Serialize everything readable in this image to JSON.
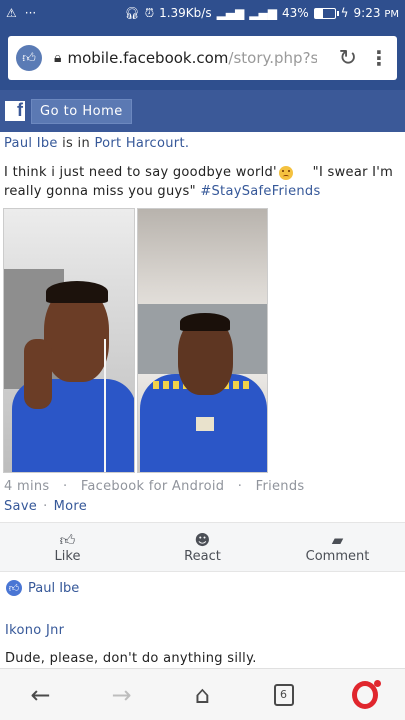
{
  "status_bar": {
    "left_icons": [
      "⚠",
      "···"
    ],
    "speed": "1.39Kb/s",
    "battery": "43%",
    "battery_fraction": 0.43,
    "time": "9:23",
    "time_suffix": "PM"
  },
  "browser": {
    "url_main": "mobile.facebook.com",
    "url_rest": "/story.php?story_"
  },
  "fb_header": {
    "home_label": "Go to Home"
  },
  "post": {
    "author": "Paul Ibe",
    "is_in": "is in",
    "location": "Port Harcourt.",
    "text_before_emoji": "I think i just need to say goodbye world'",
    "text_after_emoji": "\"I swear I'm really gonna miss you guys\"",
    "hashtag": "#StaySafeFriends",
    "time": "4 mins",
    "source": "Facebook for Android",
    "audience": "Friends",
    "save_label": "Save",
    "more_label": "More"
  },
  "reactions": {
    "like": "Like",
    "react": "React",
    "comment": "Comment"
  },
  "commenter_bar": {
    "name": "Paul Ibe"
  },
  "comment": {
    "author": "Ikono Jnr",
    "text": "Dude, please, don't do anything silly."
  },
  "bottom_nav": {
    "tab_count": "6"
  }
}
